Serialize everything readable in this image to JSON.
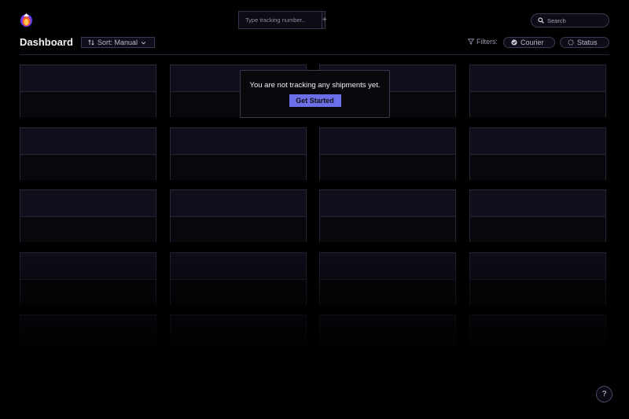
{
  "header": {
    "tracking_placeholder": "Type tracking number..",
    "add_label": "+",
    "search_placeholder": "Search"
  },
  "toolbar": {
    "title": "Dashboard",
    "sort_label": "Sort: Manual",
    "filters_label": "Filters:",
    "courier_label": "Courier",
    "status_label": "Status"
  },
  "empty_state": {
    "message": "You are not tracking any shipments yet.",
    "cta_label": "Get Started"
  },
  "help": {
    "label": "?"
  },
  "colors": {
    "accent": "#6b70e8",
    "background": "#000000"
  },
  "icons": [
    "logo-icon",
    "search-icon",
    "sort-icon",
    "chevron-down-icon",
    "filter-icon",
    "courier-icon",
    "status-icon"
  ]
}
